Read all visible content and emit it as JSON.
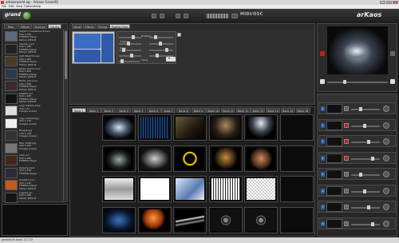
{
  "window": {
    "title": "arkaosworld.ag - Arkaos GrandVJ",
    "minimize": "_",
    "maximize": "□",
    "close": "x"
  },
  "menu": [
    "File",
    "Edit",
    "View",
    "Options",
    "Help"
  ],
  "header": {
    "logo": "grand",
    "midiosc": "MIDI/OSC",
    "brand": "arKaos"
  },
  "browser": {
    "tabs": [
      "Files",
      "Effects",
      "Sources",
      "Visuals"
    ],
    "active_tab": "Visuals",
    "items": [
      {
        "name": "Instant 1 beat0mix 01.avi",
        "details": "640 x 480\nFFMPEG Player\nMotion JPEG B"
      },
      {
        "name": "intro01 d.avi",
        "details": "640 x 480\nFFMPEG Player\nMotion JPEG B"
      },
      {
        "name": "light.Beam01.avi",
        "details": "640 x 480\nFFMPEG Player\nMotion JPEG B"
      },
      {
        "name": "Nikes_20101.mov",
        "details": "640 x 480\nFFMPEG Player\nMotion JPEG B"
      },
      {
        "name": "Nikes_101.mov",
        "details": "640 x 480\nFFMPEG Player\nMotion JPEG B"
      },
      {
        "name": "blast01 avi",
        "details": "640 x 480\nFFMPEG Player\nMotion JPEG B"
      },
      {
        "name": "Logo Galerie.bmp",
        "details": "320 x 57\nImages Loader"
      },
      {
        "name": "Logo Galerie.jpg",
        "details": "352 x 310\nImages Loader"
      },
      {
        "name": "Badger.jpg",
        "details": "176 x 128\nImages Loader"
      },
      {
        "name": "DSC_0005.jpg",
        "details": "640 x 480\nImages Loader"
      },
      {
        "name": "Lady avi",
        "details": "640 x 480\nFFMPEG Player"
      },
      {
        "name": "Galaxie.mp4",
        "details": "320 x 240\nFFMPEG Player"
      },
      {
        "name": "Small01.mov",
        "details": "320 x 240\nFFMPEG Player\nMotion JPEG B"
      },
      {
        "name": "Logo01.avi",
        "details": "640 x 480\nMotion JPEG B"
      }
    ]
  },
  "params": {
    "tabs": [
      "Visual",
      "Effects",
      "Mixing",
      "Position/Size"
    ],
    "active_tab": "Position/Size",
    "labels": {
      "rotation": "Rotation",
      "position": "Position",
      "scale": "Scale",
      "tiling": "Tiling"
    },
    "position_value": "2"
  },
  "banks": {
    "labels": [
      "Bank 1",
      "Bank 2",
      "Bank 3",
      "Bank 4",
      "Bank 5",
      "Bank 6",
      "Bank 7",
      "Bank 8",
      "Bank 9",
      "Bank 10",
      "Bank 11",
      "Bank 12",
      "Bank 13",
      "Bank 14",
      "Bank 15",
      "Bank 16"
    ],
    "active": "Bank 1"
  },
  "grid": {
    "cells": [
      "ice-tunnel",
      "waveform",
      "corridor",
      "dancer",
      "stage-lights",
      "",
      "dark-tunnel",
      "face",
      "yellow-ring",
      "robot",
      "fighter",
      "",
      "face-bw",
      "coda-logo",
      "screen",
      "pattern-bw",
      "checker",
      "",
      "coda-logo-blue",
      "orange-sphere",
      "streaks",
      "frame-square",
      "frame-square",
      ""
    ]
  },
  "layers": {
    "rows": [
      {
        "num": "1",
        "red": false
      },
      {
        "num": "2",
        "red": true
      },
      {
        "num": "3",
        "red": true
      },
      {
        "num": "4",
        "red": true
      },
      {
        "num": "5",
        "red": false
      },
      {
        "num": "6",
        "red": false
      },
      {
        "num": "7",
        "red": false
      },
      {
        "num": "8",
        "red": false
      }
    ]
  },
  "status": "grandVJ-fx bass: 21.7 D"
}
